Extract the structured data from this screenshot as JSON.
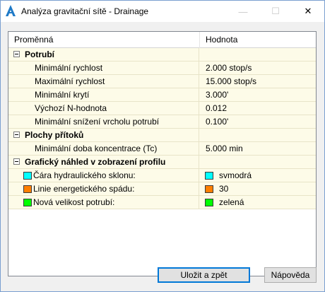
{
  "window": {
    "title": "Analýza gravitační sítě - Drainage",
    "min_glyph": "—",
    "max_glyph": "☐",
    "close_glyph": "✕"
  },
  "grid": {
    "columns": [
      "Proměnná",
      "Hodnota"
    ],
    "groups": [
      {
        "label": "Potrubí",
        "expanded": true,
        "rows": [
          {
            "name": "Minimální rychlost",
            "value": "2.000 stop/s"
          },
          {
            "name": "Maximální rychlost",
            "value": "15.000 stop/s"
          },
          {
            "name": "Minimální krytí",
            "value": "3.000'"
          },
          {
            "name": "Výchozí N-hodnota",
            "value": "0.012"
          },
          {
            "name": "Minimální snížení vrcholu potrubí",
            "value": "0.100'"
          }
        ]
      },
      {
        "label": "Plochy přítoků",
        "expanded": true,
        "rows": [
          {
            "name": "Minimální doba koncentrace (Tc)",
            "value": "5.000 min"
          }
        ]
      },
      {
        "label": "Grafický náhled v zobrazení profilu",
        "expanded": true,
        "color_rows": [
          {
            "name": "Čára hydraulického sklonu:",
            "value": "svmodrá",
            "color": "#00ffff"
          },
          {
            "name": "Linie energetického spádu:",
            "value": "30",
            "color": "#ff7f00"
          },
          {
            "name": "Nová velikost potrubí:",
            "value": "zelená",
            "color": "#00ff00"
          }
        ]
      }
    ]
  },
  "buttons": {
    "save": "Uložit a zpět",
    "help": "Nápověda"
  },
  "colors": {
    "row_background": "#fdfbe8",
    "app_icon": "#1f7ac7"
  }
}
